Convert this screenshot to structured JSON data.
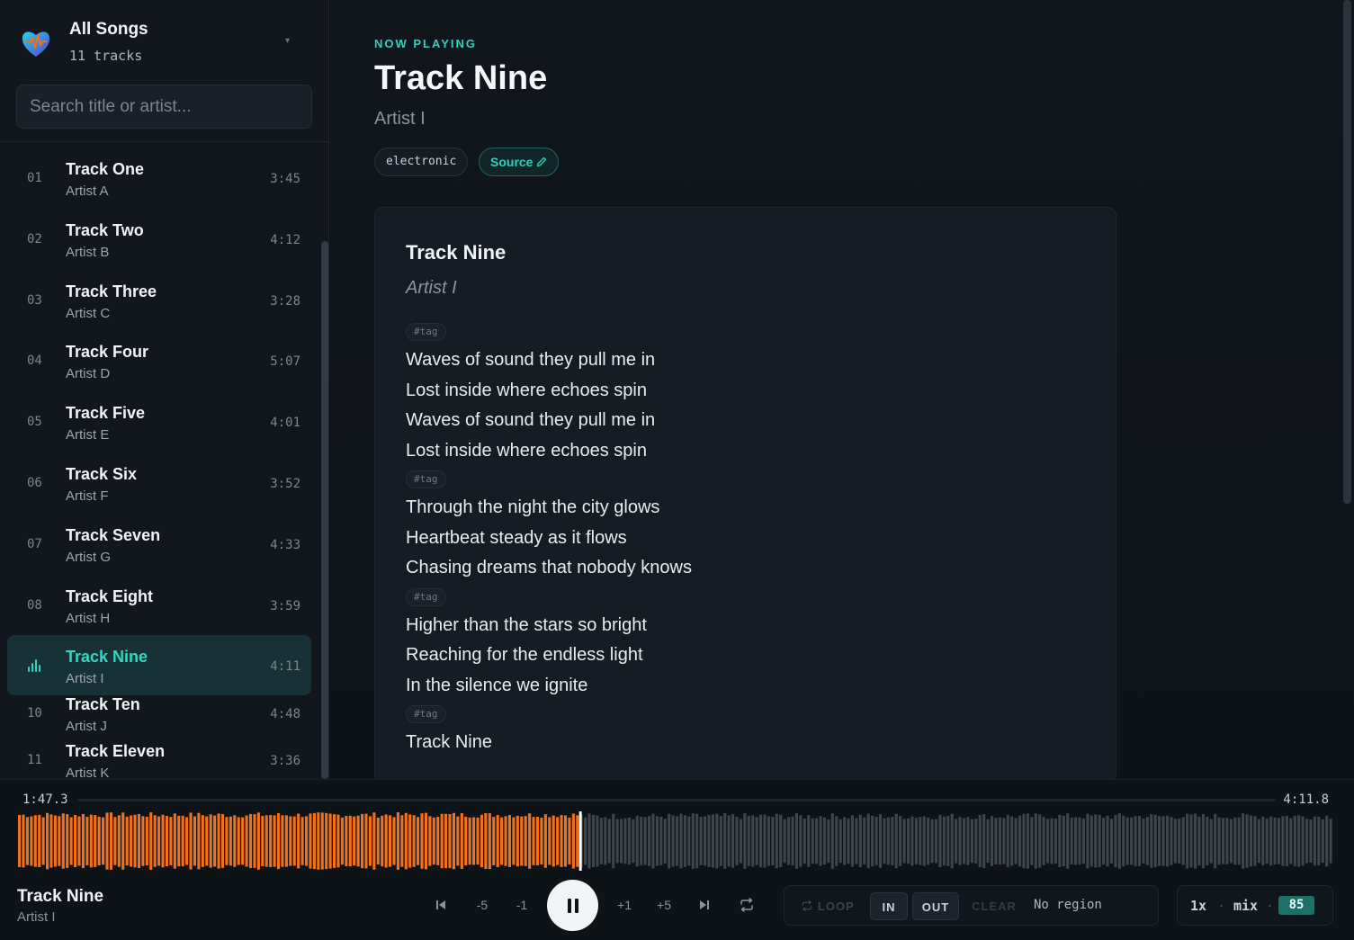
{
  "sidebar": {
    "title": "All Songs",
    "count": "11 tracks",
    "search_placeholder": "Search title or artist...",
    "tracks": [
      {
        "num": "01",
        "title": "Track One",
        "artist": "Artist A",
        "duration": "3:45"
      },
      {
        "num": "02",
        "title": "Track Two",
        "artist": "Artist B",
        "duration": "4:12"
      },
      {
        "num": "03",
        "title": "Track Three",
        "artist": "Artist C",
        "duration": "3:28"
      },
      {
        "num": "04",
        "title": "Track Four",
        "artist": "Artist D",
        "duration": "5:07"
      },
      {
        "num": "05",
        "title": "Track Five",
        "artist": "Artist E",
        "duration": "4:01"
      },
      {
        "num": "06",
        "title": "Track Six",
        "artist": "Artist F",
        "duration": "3:52"
      },
      {
        "num": "07",
        "title": "Track Seven",
        "artist": "Artist G",
        "duration": "4:33"
      },
      {
        "num": "08",
        "title": "Track Eight",
        "artist": "Artist H",
        "duration": "3:59"
      },
      {
        "num": "09",
        "title": "Track Nine",
        "artist": "Artist I",
        "duration": "4:11",
        "playing": true
      },
      {
        "num": "10",
        "title": "Track Ten",
        "artist": "Artist J",
        "duration": "4:48"
      },
      {
        "num": "11",
        "title": "Track Eleven",
        "artist": "Artist K",
        "duration": "3:36"
      }
    ]
  },
  "now_playing": {
    "label": "NOW PLAYING",
    "title": "Track Nine",
    "artist": "Artist I",
    "genre": "electronic",
    "source_label": "Source"
  },
  "lyrics": {
    "title": "Track Nine",
    "artist": "Artist I",
    "tag_label": "#tag",
    "sections": [
      [
        "Waves of sound they pull me in",
        "Lost inside where echoes spin",
        "Waves of sound they pull me in",
        "Lost inside where echoes spin"
      ],
      [
        "Through the night the city glows",
        "Heartbeat steady as it flows",
        "Chasing dreams that nobody knows"
      ],
      [
        "Higher than the stars so bright",
        "Reaching for the endless light",
        "In the silence we ignite"
      ],
      [
        "Track Nine"
      ]
    ]
  },
  "player": {
    "current_time": "1:47.3",
    "total_time": "4:11.8",
    "progress": 0.427,
    "title": "Track Nine",
    "artist": "Artist I",
    "controls": {
      "back5": "-5",
      "back1": "-1",
      "fwd1": "+1",
      "fwd5": "+5"
    },
    "loop": {
      "loop_label": "LOOP",
      "in_label": "IN",
      "out_label": "OUT",
      "clear_label": "CLEAR",
      "region_status": "No region"
    },
    "speed": "1x",
    "mix_label": "mix",
    "mix_value": "85"
  },
  "colors": {
    "accent": "#2fd1bd",
    "waveform_played": "#f2711c",
    "waveform_unplayed": "#3f454d",
    "background": "#0d1117"
  },
  "icons": {
    "logo": "heart-waveform-logo-icon",
    "pencil": "pencil-icon",
    "equalizer": "equalizer-icon",
    "skip_prev": "skip-previous-icon",
    "skip_next": "skip-next-icon",
    "pause": "pause-icon",
    "repeat": "repeat-icon"
  }
}
